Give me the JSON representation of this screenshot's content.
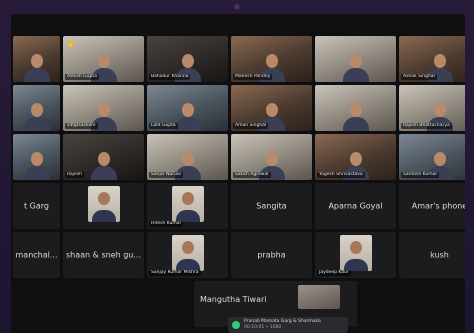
{
  "meeting": {
    "participants": [
      {
        "name": "",
        "kind": "video",
        "tone": "warm",
        "raise": false
      },
      {
        "name": "Ashish Gupta",
        "kind": "video",
        "tone": "light",
        "raise": true
      },
      {
        "name": "Bahadur Khanna",
        "kind": "video",
        "tone": "dark",
        "raise": false
      },
      {
        "name": "Mahesh Pandey",
        "kind": "video",
        "tone": "warm",
        "raise": false
      },
      {
        "name": "",
        "kind": "video",
        "tone": "light",
        "raise": false
      },
      {
        "name": "Ashok Singhal",
        "kind": "video",
        "tone": "warm",
        "raise": false
      },
      {
        "name": "",
        "kind": "video",
        "tone": "cool",
        "raise": false
      },
      {
        "name": "sdfgtsaskam",
        "kind": "video",
        "tone": "light",
        "raise": false
      },
      {
        "name": "Lalit Gupta",
        "kind": "video",
        "tone": "cool",
        "raise": false
      },
      {
        "name": "Aman Singhal",
        "kind": "video",
        "tone": "warm",
        "raise": false
      },
      {
        "name": "",
        "kind": "video",
        "tone": "light",
        "raise": false
      },
      {
        "name": "Rajesh Bhattacharya",
        "kind": "video",
        "tone": "light",
        "raise": false
      },
      {
        "name": "",
        "kind": "video",
        "tone": "cool",
        "raise": false
      },
      {
        "name": "Rajesh",
        "kind": "video",
        "tone": "dark",
        "raise": false
      },
      {
        "name": "Sanjiv Narula",
        "kind": "video",
        "tone": "light",
        "raise": false
      },
      {
        "name": "Satish Agrawal",
        "kind": "video",
        "tone": "light",
        "raise": false
      },
      {
        "name": "Yogesh Shrivastava",
        "kind": "video",
        "tone": "warm",
        "raise": false
      },
      {
        "name": "Santosh Kumar",
        "kind": "video",
        "tone": "cool",
        "raise": false
      },
      {
        "name": "",
        "kind": "text",
        "label": "t Garg"
      },
      {
        "name": "",
        "kind": "photo"
      },
      {
        "name": "Hitesh Kumar",
        "kind": "photo"
      },
      {
        "name": "",
        "kind": "text",
        "label": "Sangita"
      },
      {
        "name": "",
        "kind": "text",
        "label": "Aparna Goyal"
      },
      {
        "name": "",
        "kind": "text",
        "label": "Amar's phone"
      },
      {
        "name": "",
        "kind": "text",
        "label": "manchal..."
      },
      {
        "name": "",
        "kind": "text",
        "label": "shaan & sneh gu..."
      },
      {
        "name": "Sanjay Kumar Mishra",
        "kind": "photo"
      },
      {
        "name": "",
        "kind": "text",
        "label": "prabha"
      },
      {
        "name": "Jaydeep Kaur",
        "kind": "photo"
      },
      {
        "name": "",
        "kind": "text",
        "label": "kush"
      }
    ],
    "bottom_tile": {
      "label": "Mangutha Tiwari"
    },
    "toast": {
      "line1": "Pranab Mamata Garg & Sharmaka",
      "line2": "00:10:01 • 1080"
    }
  }
}
